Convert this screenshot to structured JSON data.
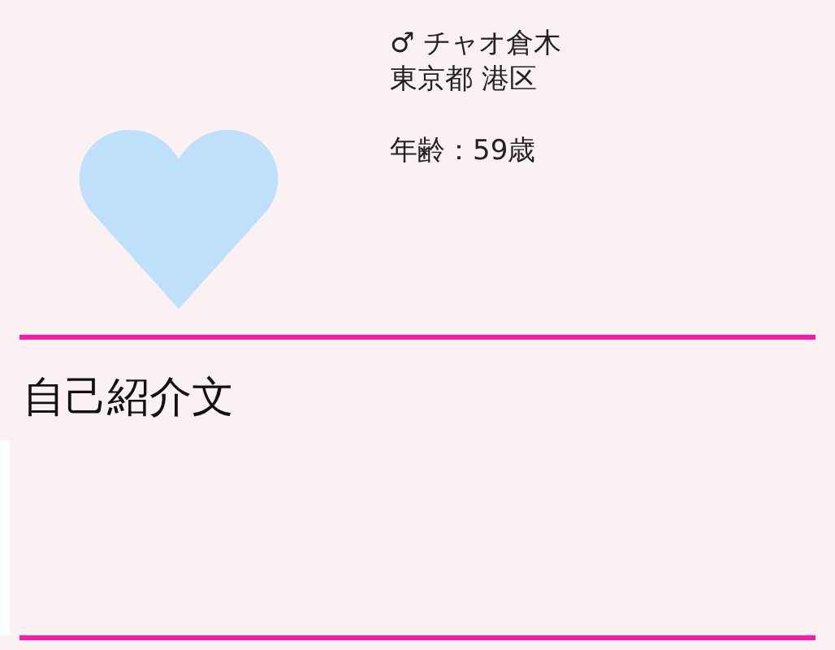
{
  "profile": {
    "name_line": "♂ チャオ倉木",
    "location": "東京都 港区",
    "age": "年齢：59歳"
  },
  "intro": {
    "heading": "自己紹介文"
  }
}
